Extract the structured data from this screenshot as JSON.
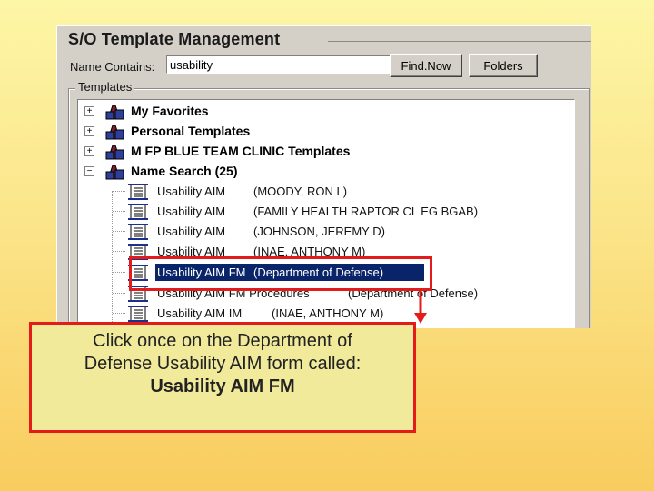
{
  "window": {
    "title": "S/O Template Management",
    "name_contains_label": "Name Contains:",
    "search_value": "usability",
    "find_button": "Find.Now",
    "folders_button": "Folders",
    "group_label": "Templates"
  },
  "tree": {
    "folders": [
      {
        "label": "My Favorites",
        "expander": "+"
      },
      {
        "label": "Personal Templates",
        "expander": "+"
      },
      {
        "label": "M FP BLUE TEAM CLINIC Templates",
        "expander": "+"
      },
      {
        "label": "Name Search (25)",
        "expander": "−"
      }
    ],
    "results": [
      {
        "name": "Usability AIM",
        "owner": "(MOODY, RON L)"
      },
      {
        "name": "Usability AIM",
        "owner": "(FAMILY HEALTH RAPTOR CL EG BGAB)"
      },
      {
        "name": "Usability AIM",
        "owner": "(JOHNSON, JEREMY D)"
      },
      {
        "name": "Usability AIM",
        "owner": "(INAE, ANTHONY M)"
      },
      {
        "name": "Usability AIM FM",
        "owner": "(Department of Defense)"
      },
      {
        "name": "Usability AIM FM Procedures",
        "owner": "(Department of Defense)"
      },
      {
        "name": "Usability AIM IM",
        "owner": "(INAE, ANTHONY M)"
      }
    ]
  },
  "callout": {
    "line1": "Click once on the Department of",
    "line2": "Defense Usability AIM form called:",
    "line3": "Usability AIM FM"
  },
  "colors": {
    "highlight": "#e31b1b",
    "selection": "#0a246a",
    "callout_bg": "#f0ea9a"
  }
}
